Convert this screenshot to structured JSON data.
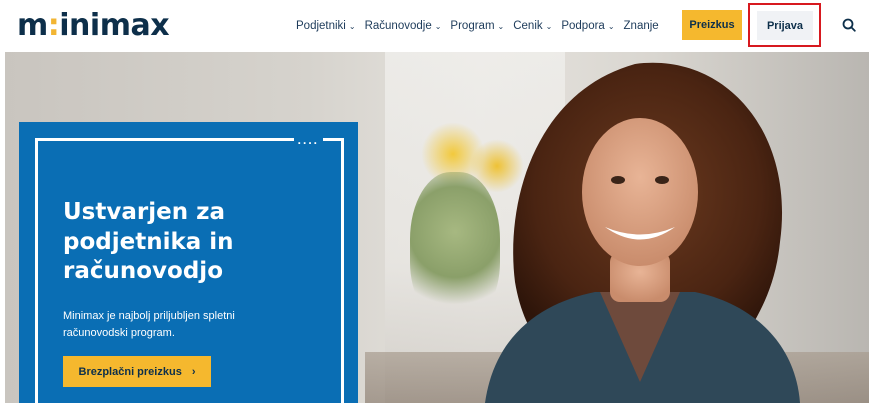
{
  "header": {
    "logo": {
      "prefix": "m",
      "dot": ":",
      "rest": "inimax"
    },
    "nav": [
      {
        "label": "Podjetniki",
        "has_dropdown": true
      },
      {
        "label": "Računovodje",
        "has_dropdown": true
      },
      {
        "label": "Program",
        "has_dropdown": true
      },
      {
        "label": "Cenik",
        "has_dropdown": true
      },
      {
        "label": "Podpora",
        "has_dropdown": true
      },
      {
        "label": "Znanje",
        "has_dropdown": false
      }
    ],
    "trial_label": "Preizkus",
    "login_label": "Prijava",
    "search_icon": "search-icon"
  },
  "hero": {
    "title": "Ustvarjen za podjetnika in računovodjo",
    "text": "Minimax je najbolj priljubljen spletni računovodski program.",
    "cta_label": "Brezplačni preizkus",
    "cta_icon": "chevron-right-icon",
    "dots": "...."
  },
  "colors": {
    "brand_blue": "#0a6eb4",
    "accent_yellow": "#f5b82e",
    "navy": "#0d2f4a",
    "highlight_red": "#d7191f"
  }
}
